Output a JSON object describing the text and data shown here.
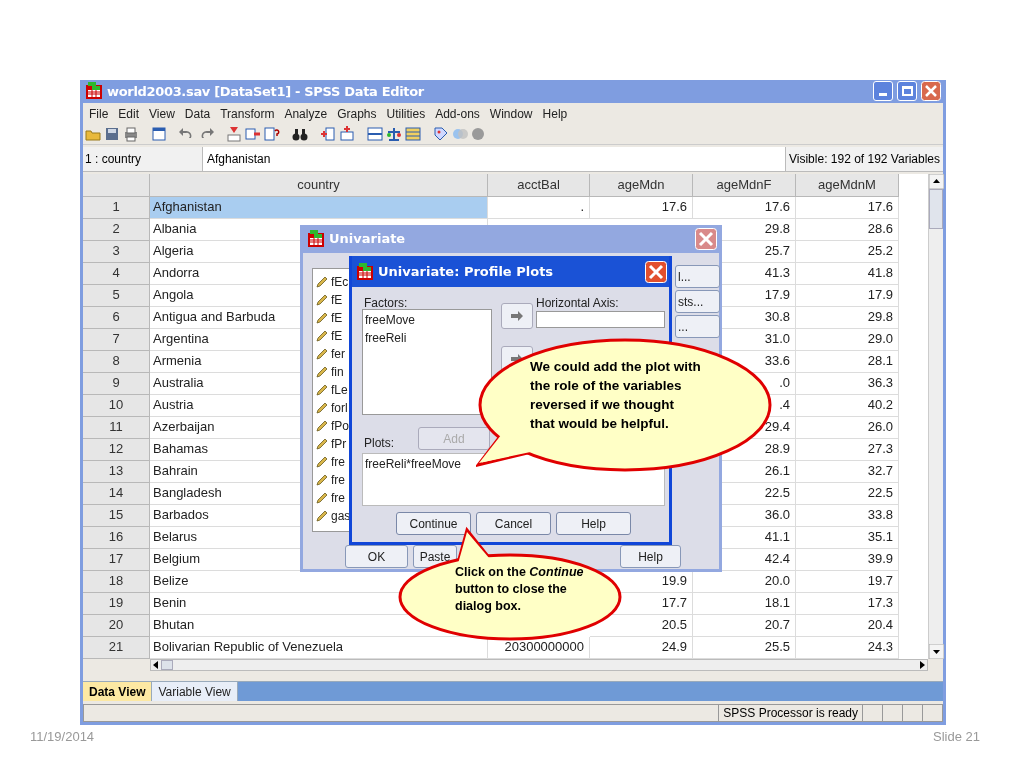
{
  "window": {
    "title": "world2003.sav [DataSet1] - SPSS Data Editor",
    "menu": [
      "File",
      "Edit",
      "View",
      "Data",
      "Transform",
      "Analyze",
      "Graphs",
      "Utilities",
      "Add-ons",
      "Window",
      "Help"
    ],
    "cell_ref": "1 : country",
    "cell_value": "Afghanistan",
    "visible_vars": "Visible: 192 of 192 Variables"
  },
  "table": {
    "columns": [
      "country",
      "acctBal",
      "ageMdn",
      "ageMdnF",
      "ageMdnM"
    ],
    "rows": [
      {
        "number": "1",
        "cells": [
          "Afghanistan",
          ".",
          "17.6",
          "17.6",
          "17.6"
        ],
        "selected": true
      },
      {
        "number": "2",
        "cells": [
          "Albania",
          null,
          null,
          "29.8",
          "28.6"
        ],
        "selected": false
      },
      {
        "number": "3",
        "cells": [
          "Algeria",
          null,
          null,
          "25.7",
          "25.2"
        ],
        "selected": false
      },
      {
        "number": "4",
        "cells": [
          "Andorra",
          null,
          null,
          "41.3",
          "41.8"
        ],
        "selected": false
      },
      {
        "number": "5",
        "cells": [
          "Angola",
          null,
          null,
          "17.9",
          "17.9"
        ],
        "selected": false
      },
      {
        "number": "6",
        "cells": [
          "Antigua and Barbuda",
          null,
          null,
          "30.8",
          "29.8"
        ],
        "selected": false
      },
      {
        "number": "7",
        "cells": [
          "Argentina",
          null,
          null,
          "31.0",
          "29.0"
        ],
        "selected": false
      },
      {
        "number": "8",
        "cells": [
          "Armenia",
          null,
          null,
          "33.6",
          "28.1"
        ],
        "selected": false
      },
      {
        "number": "9",
        "cells": [
          "Australia",
          null,
          null,
          ".0",
          "36.3"
        ],
        "selected": false
      },
      {
        "number": "10",
        "cells": [
          "Austria",
          null,
          null,
          ".4",
          "40.2"
        ],
        "selected": false
      },
      {
        "number": "11",
        "cells": [
          "Azerbaijan",
          null,
          null,
          "29.4",
          "26.0"
        ],
        "selected": false
      },
      {
        "number": "12",
        "cells": [
          "Bahamas",
          null,
          null,
          "28.9",
          "27.3"
        ],
        "selected": false
      },
      {
        "number": "13",
        "cells": [
          "Bahrain",
          null,
          null,
          "26.1",
          "32.7"
        ],
        "selected": false
      },
      {
        "number": "14",
        "cells": [
          "Bangladesh",
          null,
          null,
          "22.5",
          "22.5"
        ],
        "selected": false
      },
      {
        "number": "15",
        "cells": [
          "Barbados",
          null,
          null,
          "36.0",
          "33.8"
        ],
        "selected": false
      },
      {
        "number": "16",
        "cells": [
          "Belarus",
          null,
          null,
          "41.1",
          "35.1"
        ],
        "selected": false
      },
      {
        "number": "17",
        "cells": [
          "Belgium",
          null,
          null,
          "42.4",
          "39.9"
        ],
        "selected": false
      },
      {
        "number": "18",
        "cells": [
          "Belize",
          null,
          "19.9",
          "20.0",
          "19.7"
        ],
        "selected": false
      },
      {
        "number": "19",
        "cells": [
          "Benin",
          null,
          "17.7",
          "18.1",
          "17.3"
        ],
        "selected": false
      },
      {
        "number": "20",
        "cells": [
          "Bhutan",
          null,
          "20.5",
          "20.7",
          "20.4"
        ],
        "selected": false
      },
      {
        "number": "21",
        "cells": [
          "Bolivarian Republic of Venezuela",
          "20300000000",
          "24.9",
          "25.5",
          "24.3"
        ],
        "selected": false
      }
    ]
  },
  "view_tabs": [
    {
      "label": "Data View",
      "selected": true
    },
    {
      "label": "Variable View",
      "selected": false
    }
  ],
  "status_bar": "SPSS Processor is ready",
  "univariate_dialog": {
    "title": "Univariate",
    "variables": [
      "fEc",
      "fE",
      "fE",
      "fE",
      "fer",
      "fin",
      "fLe",
      "forl",
      "fPo",
      "fPr",
      "fre",
      "fre",
      "fre",
      "gas"
    ],
    "side_buttons": [
      "l...",
      "sts...",
      "..."
    ],
    "buttons": [
      "OK",
      "Paste",
      "Help"
    ]
  },
  "profile_plots_dialog": {
    "title": "Univariate: Profile Plots",
    "factors_label": "Factors:",
    "factors": [
      "freeMove",
      "freeReli"
    ],
    "horizontal_axis_label": "Horizontal Axis:",
    "plots_label": "Plots:",
    "add_button": {
      "label": "Add",
      "disabled": true
    },
    "plots": [
      "freeReli*freeMove"
    ],
    "buttons": [
      "Continue",
      "Cancel",
      "Help"
    ]
  },
  "callouts": [
    {
      "text": "We could add the plot with the role of the variables reversed if we thought that would be helpful."
    },
    {
      "text": "Click on the *Continue* button to close the dialog box."
    }
  ],
  "slide": {
    "date": "11/19/2014",
    "number": "Slide 21"
  }
}
